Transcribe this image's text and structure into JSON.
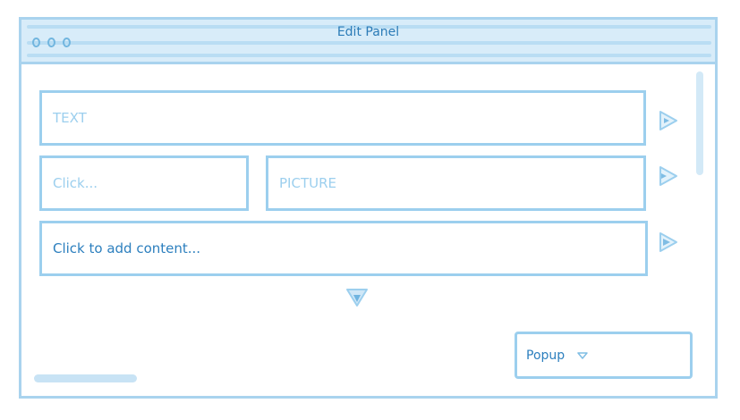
{
  "window": {
    "title": "Edit Panel"
  },
  "fields": {
    "text_placeholder": "TEXT",
    "click_placeholder": "Click...",
    "picture_placeholder": "PICTURE",
    "content_text": "Click to add content..."
  },
  "popup": {
    "label": "Popup"
  },
  "icons": {
    "play": "play-triangle-icon",
    "down": "down-triangle-icon",
    "caret": "chevron-down-icon"
  },
  "colors": {
    "accent": "#2c7fbe",
    "outline": "#9ccfee",
    "titlebar": "#d8ecf9"
  }
}
